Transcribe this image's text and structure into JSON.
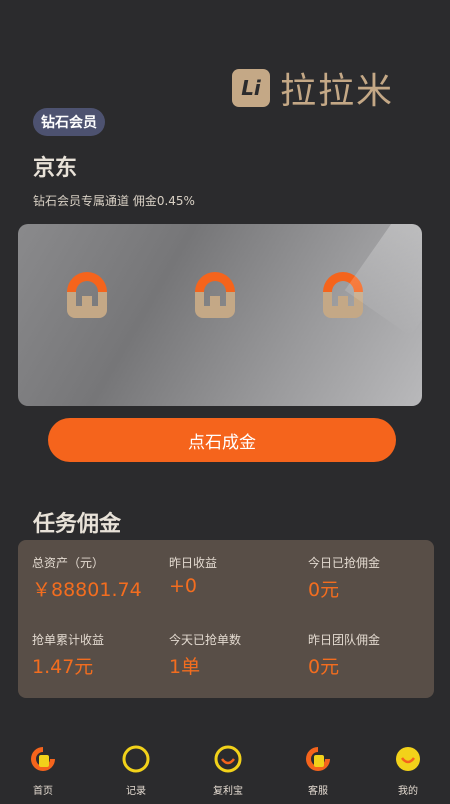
{
  "brand": {
    "logo_mark": "Li",
    "name": "拉拉米"
  },
  "member_badge": "钻石会员",
  "platform_title": "京东",
  "channel_subtitle": "钻石会员专属通道 佣金0.45%",
  "cta_label": "点石成金",
  "section_title": "任务佣金",
  "stats": {
    "total_assets_label": "总资产（元）",
    "total_assets_value": "￥88801.74",
    "yesterday_income_label": "昨日收益",
    "yesterday_income_value": "+0",
    "today_commission_label": "今日已抢佣金",
    "today_commission_value": "0元",
    "cumulative_income_label": "抢单累计收益",
    "cumulative_income_value": "1.47元",
    "today_orders_label": "今天已抢单数",
    "today_orders_value": "1单",
    "team_commission_label": "昨日团队佣金",
    "team_commission_value": "0元"
  },
  "tabs": [
    {
      "label": "首页",
      "icon": "home-magnet-icon"
    },
    {
      "label": "记录",
      "icon": "record-circle-icon"
    },
    {
      "label": "复利宝",
      "icon": "smile-circle-icon"
    },
    {
      "label": "客服",
      "icon": "service-magnet-icon"
    },
    {
      "label": "我的",
      "icon": "profile-smile-icon"
    }
  ],
  "colors": {
    "accent": "#f5641c",
    "gold": "#c4a886",
    "background": "#2b2b2d",
    "panel": "#584e47",
    "tab_yellow": "#f2d21a"
  }
}
